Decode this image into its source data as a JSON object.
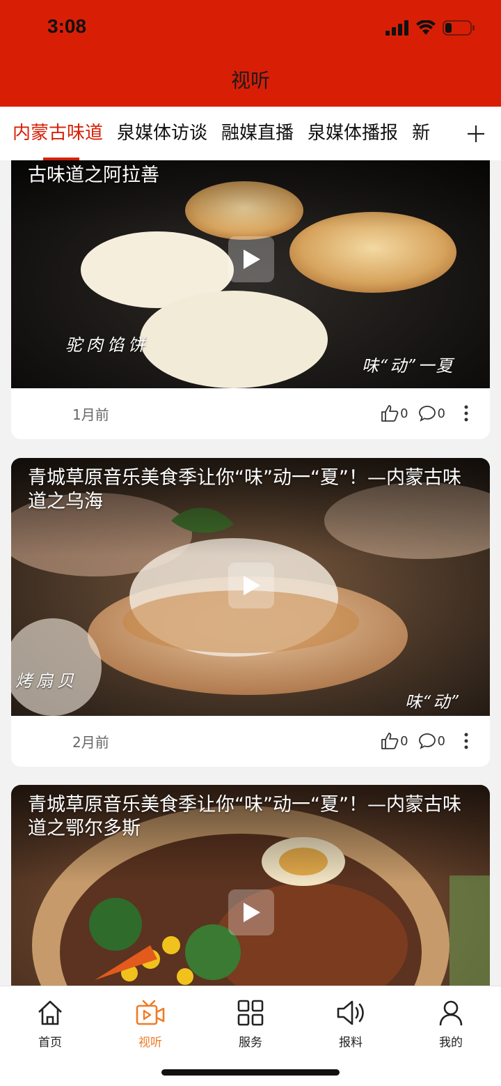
{
  "status_bar": {
    "time": "3:08"
  },
  "header": {
    "title": "视听"
  },
  "tabs": [
    {
      "label": "内蒙古味道",
      "active": true
    },
    {
      "label": "泉媒体访谈",
      "active": false
    },
    {
      "label": "融媒直播",
      "active": false
    },
    {
      "label": "泉媒体播报",
      "active": false
    },
    {
      "label": "新",
      "active": false
    }
  ],
  "tabs_add_icon": "plus-icon",
  "feed": {
    "items": [
      {
        "title": "古味道之阿拉善",
        "overlay_left": "驼肉馅饼",
        "overlay_right": "味“动”一夏",
        "time": "1月前",
        "likes": "0",
        "comments": "0"
      },
      {
        "title": "青城草原音乐美食季让你“味”动一“夏”！—内蒙古味道之乌海",
        "overlay_left": "烤扇贝",
        "overlay_right": "味“动”",
        "time": "2月前",
        "likes": "0",
        "comments": "0"
      },
      {
        "title": "青城草原音乐美食季让你“味”动一“夏”！—内蒙古味道之鄂尔多斯"
      }
    ]
  },
  "bottom_nav": [
    {
      "label": "首页",
      "icon": "home-icon",
      "active": false
    },
    {
      "label": "视听",
      "icon": "video-tv-icon",
      "active": true
    },
    {
      "label": "服务",
      "icon": "grid-icon",
      "active": false
    },
    {
      "label": "报料",
      "icon": "speaker-icon",
      "active": false
    },
    {
      "label": "我的",
      "icon": "user-icon",
      "active": false
    }
  ],
  "colors": {
    "brand_red": "#d81f06",
    "active_nav": "#f07b25"
  }
}
